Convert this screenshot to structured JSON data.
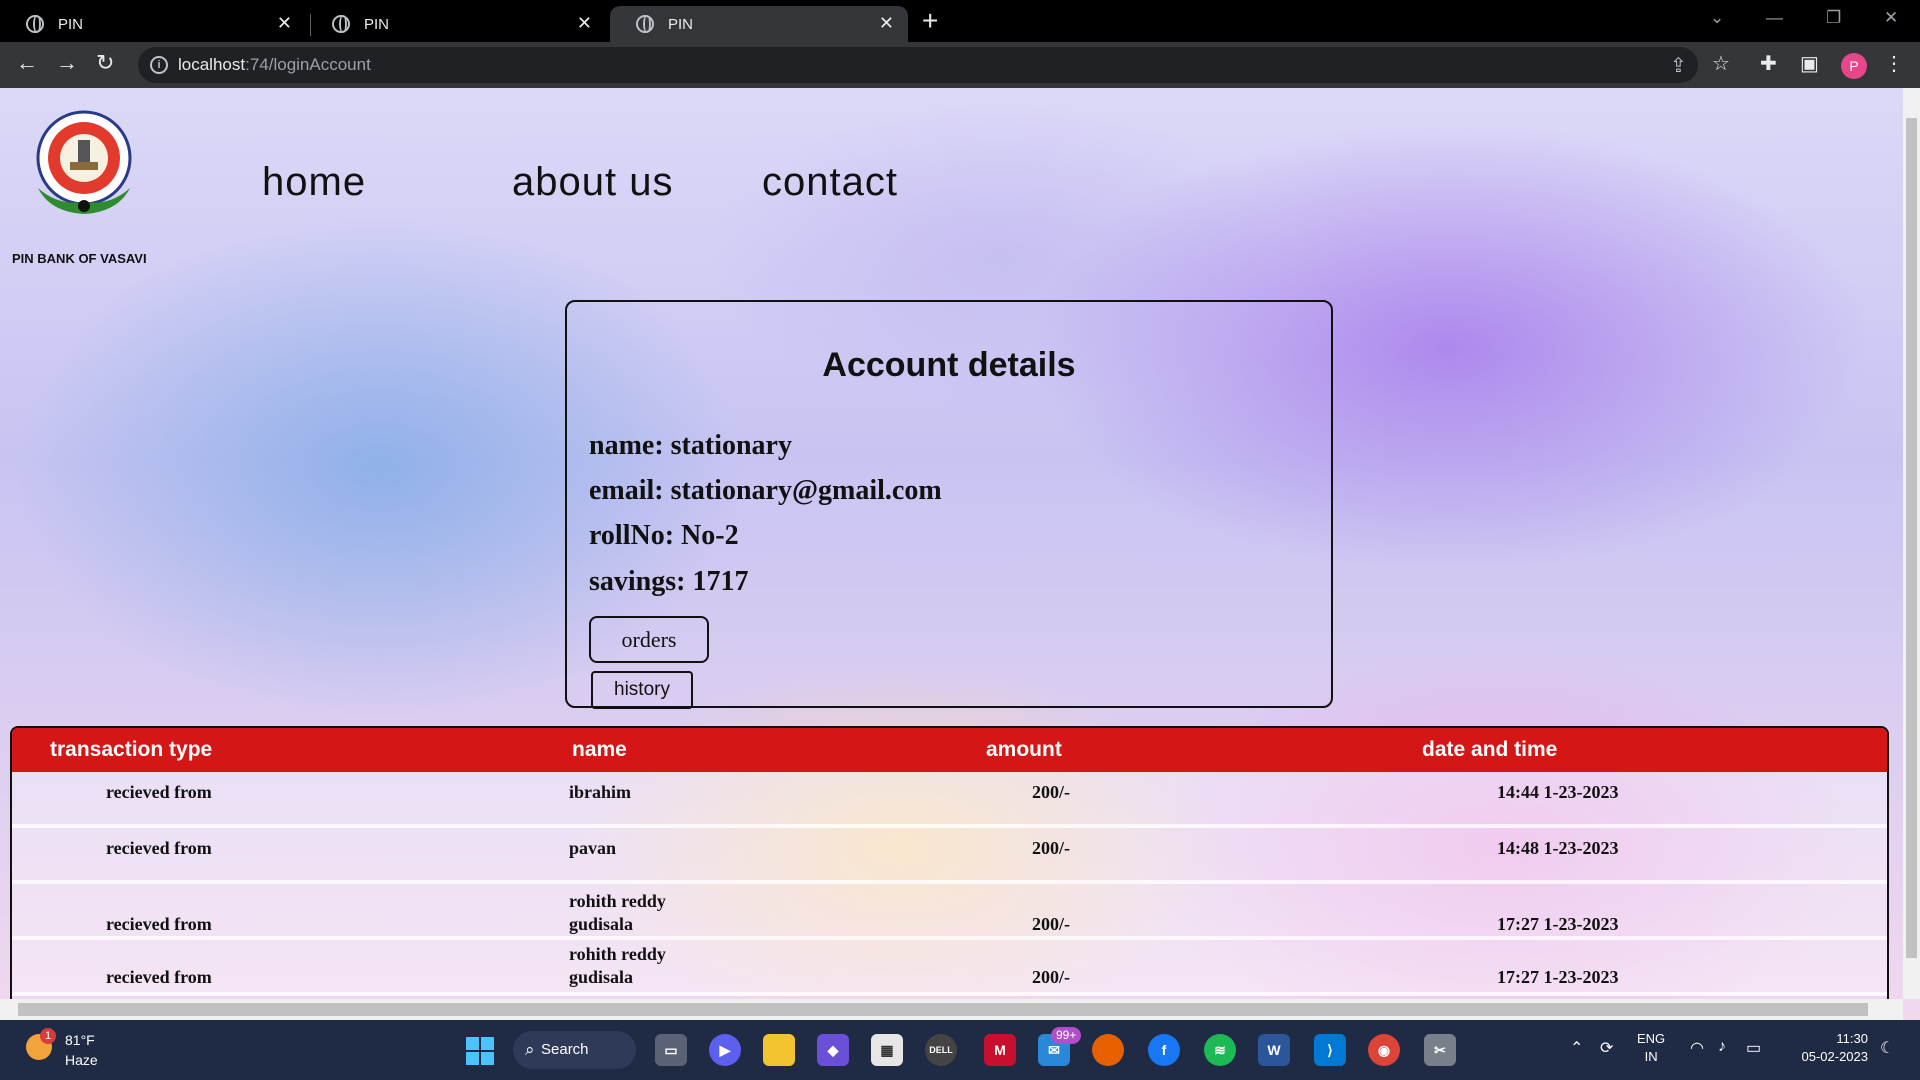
{
  "browser": {
    "tabs": [
      {
        "title": "PIN",
        "active": false
      },
      {
        "title": "PIN",
        "active": false
      },
      {
        "title": "PIN",
        "active": true
      }
    ],
    "url_host": "localhost",
    "url_path": ":74/loginAccount",
    "profile_initial": "P"
  },
  "page": {
    "brand": "PIN BANK OF VASAVI",
    "nav": [
      "home",
      "about us",
      "contact"
    ],
    "account": {
      "title": "Account details",
      "name": "name: stationary",
      "email": "email: stationary@gmail.com",
      "roll": "rollNo: No-2",
      "savings": "savings: 1717",
      "orders_label": "orders",
      "history_label": "history"
    },
    "transactions": {
      "headers": [
        "transaction type",
        "name",
        "amount",
        "date and time"
      ],
      "rows": [
        {
          "type": "recieved from",
          "name": "ibrahim",
          "amount": "200/-",
          "datetime": "14:44 1-23-2023"
        },
        {
          "type": "recieved from",
          "name": "pavan",
          "amount": "200/-",
          "datetime": "14:48 1-23-2023"
        },
        {
          "type": "recieved from",
          "name": "rohith reddy\ngudisala",
          "amount": "200/-",
          "datetime": "17:27 1-23-2023"
        },
        {
          "type": "recieved from",
          "name": "rohith reddy\ngudisala",
          "amount": "200/-",
          "datetime": "17:27 1-23-2023"
        }
      ]
    }
  },
  "taskbar": {
    "weather_temp": "81°F",
    "weather_desc": "Haze",
    "weather_badge": "1",
    "search_label": "Search",
    "teams_badge": "99+",
    "lang_primary": "ENG",
    "lang_secondary": "IN",
    "time": "11:30",
    "date": "05-02-2023"
  },
  "colors": {
    "table_header": "#d51616",
    "taskbar": "#1f2a44",
    "chrome_toolbar": "#35363a"
  }
}
